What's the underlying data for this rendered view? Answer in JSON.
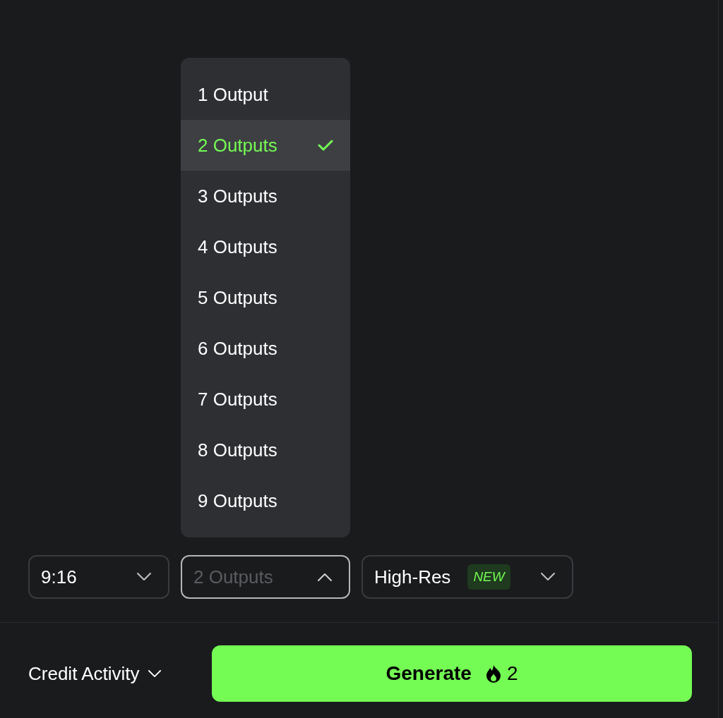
{
  "dropdown_menu": {
    "items": [
      {
        "label": "1 Output",
        "selected": false
      },
      {
        "label": "2 Outputs",
        "selected": true
      },
      {
        "label": "3 Outputs",
        "selected": false
      },
      {
        "label": "4 Outputs",
        "selected": false
      },
      {
        "label": "5 Outputs",
        "selected": false
      },
      {
        "label": "6 Outputs",
        "selected": false
      },
      {
        "label": "7 Outputs",
        "selected": false
      },
      {
        "label": "8 Outputs",
        "selected": false
      },
      {
        "label": "9 Outputs",
        "selected": false
      }
    ]
  },
  "selects": [
    {
      "kind": "plain",
      "value": "9:16",
      "expanded": false
    },
    {
      "kind": "plain",
      "value": "2 Outputs",
      "expanded": true
    },
    {
      "kind": "badge",
      "value": "High-Res",
      "badge": "NEW",
      "expanded": false
    }
  ],
  "footer": {
    "credit_activity": "Credit Activity",
    "generate_button": {
      "label": "Generate",
      "cost": "2"
    }
  }
}
